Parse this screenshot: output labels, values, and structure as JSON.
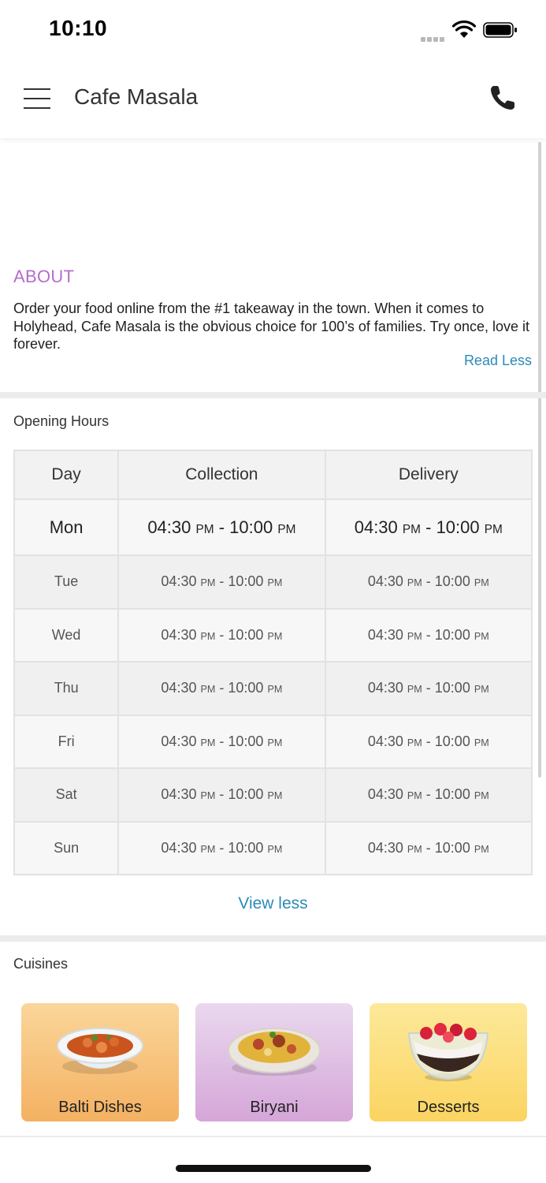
{
  "status_bar": {
    "time": "10:10"
  },
  "header": {
    "title": "Cafe Masala"
  },
  "about": {
    "heading": "ABOUT",
    "text": "Order your food online from the #1 takeaway in the town. When it comes to Holyhead, Cafe Masala is the obvious choice for 100’s of families. Try once, love it forever.",
    "read_less": "Read Less"
  },
  "opening_hours": {
    "title": "Opening Hours",
    "columns": [
      "Day",
      "Collection",
      "Delivery"
    ],
    "rows": [
      {
        "day": "Mon",
        "collection": {
          "open": "04:30",
          "open_ampm": "PM",
          "close": "10:00",
          "close_ampm": "PM"
        },
        "delivery": {
          "open": "04:30",
          "open_ampm": "PM",
          "close": "10:00",
          "close_ampm": "PM"
        }
      },
      {
        "day": "Tue",
        "collection": {
          "open": "04:30",
          "open_ampm": "PM",
          "close": "10:00",
          "close_ampm": "PM"
        },
        "delivery": {
          "open": "04:30",
          "open_ampm": "PM",
          "close": "10:00",
          "close_ampm": "PM"
        }
      },
      {
        "day": "Wed",
        "collection": {
          "open": "04:30",
          "open_ampm": "PM",
          "close": "10:00",
          "close_ampm": "PM"
        },
        "delivery": {
          "open": "04:30",
          "open_ampm": "PM",
          "close": "10:00",
          "close_ampm": "PM"
        }
      },
      {
        "day": "Thu",
        "collection": {
          "open": "04:30",
          "open_ampm": "PM",
          "close": "10:00",
          "close_ampm": "PM"
        },
        "delivery": {
          "open": "04:30",
          "open_ampm": "PM",
          "close": "10:00",
          "close_ampm": "PM"
        }
      },
      {
        "day": "Fri",
        "collection": {
          "open": "04:30",
          "open_ampm": "PM",
          "close": "10:00",
          "close_ampm": "PM"
        },
        "delivery": {
          "open": "04:30",
          "open_ampm": "PM",
          "close": "10:00",
          "close_ampm": "PM"
        }
      },
      {
        "day": "Sat",
        "collection": {
          "open": "04:30",
          "open_ampm": "PM",
          "close": "10:00",
          "close_ampm": "PM"
        },
        "delivery": {
          "open": "04:30",
          "open_ampm": "PM",
          "close": "10:00",
          "close_ampm": "PM"
        }
      },
      {
        "day": "Sun",
        "collection": {
          "open": "04:30",
          "open_ampm": "PM",
          "close": "10:00",
          "close_ampm": "PM"
        },
        "delivery": {
          "open": "04:30",
          "open_ampm": "PM",
          "close": "10:00",
          "close_ampm": "PM"
        }
      }
    ],
    "view_less": "View less"
  },
  "cuisines": {
    "title": "Cuisines",
    "items": [
      {
        "label": "Balti Dishes",
        "icon": "curry-bowl-icon"
      },
      {
        "label": "Biryani",
        "icon": "biryani-plate-icon"
      },
      {
        "label": "Desserts",
        "icon": "dessert-cup-icon"
      }
    ]
  },
  "colors": {
    "accent_link": "#2b8bb6",
    "about_heading": "#b66ccd",
    "card_balti": "#f4b162",
    "card_biryani": "#d5a6d8",
    "card_desserts": "#fbd461"
  }
}
